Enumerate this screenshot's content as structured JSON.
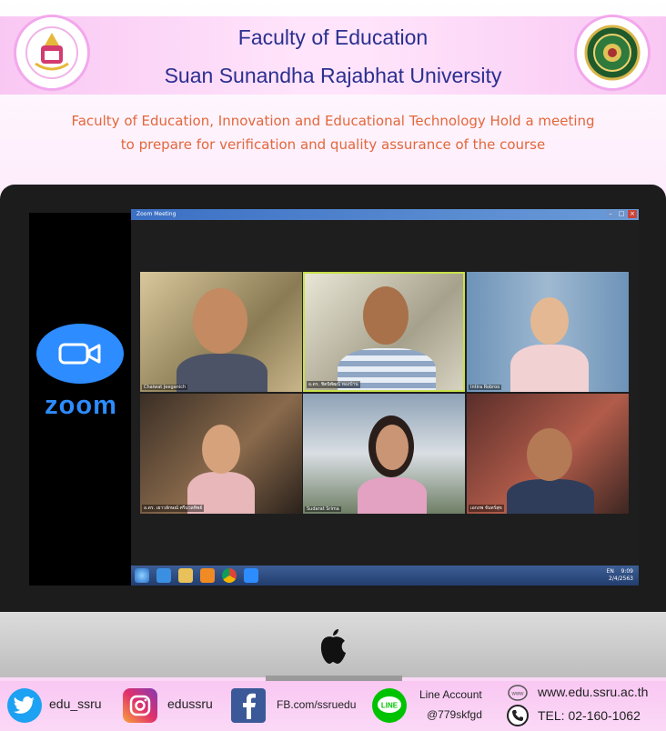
{
  "header": {
    "title_line1": "Faculty of Education",
    "title_line2": "Suan Sunandha Rajabhat University",
    "subtitle_line1": "Faculty of Education, Innovation and Educational Technology Hold a meeting",
    "subtitle_line2": "to prepare for verification and quality assurance of the course"
  },
  "zoom_brand": {
    "word": "zoom",
    "color": "#2d8cff"
  },
  "zoom_window": {
    "title": "Zoom Meeting",
    "participants": [
      {
        "name": "Chaiwat Jeeganich"
      },
      {
        "name": "อ.ดร. ชิตนิพัฒน์ ทองบ้าน"
      },
      {
        "name": "Intira Robroo"
      },
      {
        "name": "อ.ดร. เยาวลักษณ์ ศรีนวลทิพย์"
      },
      {
        "name": "Sudarat Srima"
      },
      {
        "name": "เอกภพ จันทร์สุข"
      }
    ]
  },
  "taskbar": {
    "icons": [
      "windows-start-icon",
      "ie-icon",
      "folder-icon",
      "media-icon",
      "chrome-icon",
      "zoom-app-icon"
    ],
    "lang": "EN",
    "time": "9:09",
    "date": "2/4/2563"
  },
  "footer": {
    "twitter": "edu_ssru",
    "instagram": "edussru",
    "facebook": "FB.com/ssruedu",
    "line_label": "Line Account",
    "line_id": "@779skfgd",
    "website": "www.edu.ssru.ac.th",
    "phone": "TEL: 02-160-1062"
  }
}
